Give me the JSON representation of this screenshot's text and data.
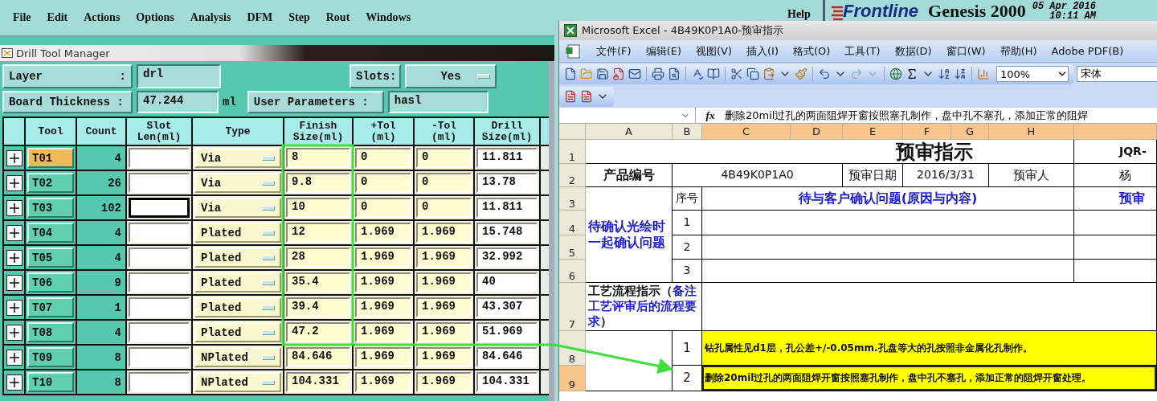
{
  "genesis": {
    "menu": [
      "File",
      "Edit",
      "Actions",
      "Options",
      "Analysis",
      "DFM",
      "Step",
      "Rout",
      "Windows"
    ],
    "help": "Help",
    "brand": "Frontline",
    "product": "Genesis 2000",
    "date": "05 Apr 2016",
    "time": "10:11 AM"
  },
  "drill_manager": {
    "title": "Drill Tool Manager",
    "layer_label": "Layer",
    "layer_colon": ":",
    "layer": "drl",
    "slots_label": "Slots:",
    "slots": "Yes",
    "thickness_label": "Board Thickness :",
    "thickness": "47.244",
    "thickness_unit": "ml",
    "user_params_label": "User Parameters :",
    "user_params": "hasl",
    "columns": [
      "Tool",
      "Count",
      "Slot\nLen(ml)",
      "Type",
      "Finish\nSize(ml)",
      "+Tol\n(ml)",
      "-Tol\n(ml)",
      "Drill\nSize(ml)"
    ],
    "rows": [
      {
        "tool": "T01",
        "selected": true,
        "count": "4",
        "slot_focused": false,
        "type": "Via",
        "finish": "8",
        "plus_tol": "0",
        "minus_tol": "0",
        "drill": "11.811"
      },
      {
        "tool": "T02",
        "selected": false,
        "count": "26",
        "slot_focused": false,
        "type": "Via",
        "finish": "9.8",
        "plus_tol": "0",
        "minus_tol": "0",
        "drill": "13.78"
      },
      {
        "tool": "T03",
        "selected": false,
        "count": "102",
        "slot_focused": true,
        "type": "Via",
        "finish": "10",
        "plus_tol": "0",
        "minus_tol": "0",
        "drill": "11.811"
      },
      {
        "tool": "T04",
        "selected": false,
        "count": "4",
        "slot_focused": false,
        "type": "Plated",
        "finish": "12",
        "plus_tol": "1.969",
        "minus_tol": "1.969",
        "drill": "15.748"
      },
      {
        "tool": "T05",
        "selected": false,
        "count": "4",
        "slot_focused": false,
        "type": "Plated",
        "finish": "28",
        "plus_tol": "1.969",
        "minus_tol": "1.969",
        "drill": "32.992"
      },
      {
        "tool": "T06",
        "selected": false,
        "count": "9",
        "slot_focused": false,
        "type": "Plated",
        "finish": "35.4",
        "plus_tol": "1.969",
        "minus_tol": "1.969",
        "drill": "40"
      },
      {
        "tool": "T07",
        "selected": false,
        "count": "1",
        "slot_focused": false,
        "type": "Plated",
        "finish": "39.4",
        "plus_tol": "1.969",
        "minus_tol": "1.969",
        "drill": "43.307"
      },
      {
        "tool": "T08",
        "selected": false,
        "count": "4",
        "slot_focused": false,
        "type": "Plated",
        "finish": "47.2",
        "plus_tol": "1.969",
        "minus_tol": "1.969",
        "drill": "51.969"
      },
      {
        "tool": "T09",
        "selected": false,
        "count": "8",
        "slot_focused": false,
        "type": "NPlated",
        "finish": "84.646",
        "plus_tol": "1.969",
        "minus_tol": "1.969",
        "drill": "84.646"
      },
      {
        "tool": "T10",
        "selected": false,
        "count": "8",
        "slot_focused": false,
        "type": "NPlated",
        "finish": "104.331",
        "plus_tol": "1.969",
        "minus_tol": "1.969",
        "drill": "104.331"
      }
    ]
  },
  "excel": {
    "title": "Microsoft Excel - 4B49K0P1A0-预审指示",
    "menu": [
      "文件(F)",
      "编辑(E)",
      "视图(V)",
      "插入(I)",
      "格式(O)",
      "工具(T)",
      "数据(D)",
      "窗口(W)",
      "帮助(H)",
      "Adobe PDF(B)"
    ],
    "zoom": "100%",
    "font": "宋体",
    "fx": "fx",
    "formula": "删除20mil过孔的两面阻焊开窗按照塞孔制作，盘中孔不塞孔，添加正常的阻焊",
    "column_headers": [
      {
        "label": "A",
        "selected": false
      },
      {
        "label": "B",
        "selected": false
      },
      {
        "label": "C",
        "selected": true
      },
      {
        "label": "D",
        "selected": true
      },
      {
        "label": "E",
        "selected": true
      },
      {
        "label": "F",
        "selected": true
      },
      {
        "label": "G",
        "selected": true
      },
      {
        "label": "H",
        "selected": true
      },
      {
        "selected": true
      }
    ],
    "row_headers": [
      {
        "label": "1",
        "selected": false
      },
      {
        "label": "2",
        "selected": false
      },
      {
        "label": "3",
        "selected": false
      },
      {
        "label": "4",
        "selected": false
      },
      {
        "label": "5",
        "selected": false
      },
      {
        "label": "6",
        "selected": false
      },
      {
        "label": "7",
        "selected": false
      },
      {
        "label": "8",
        "selected": false
      },
      {
        "label": "9",
        "selected": true
      }
    ],
    "sheet": {
      "title": "预审指示",
      "doc_code": "JQR-",
      "product_label": "产品编号",
      "product_no": "4B49K0P1A0",
      "date_label": "预审日期",
      "date": "2016/3/31",
      "reviewer_label": "预审人",
      "reviewer": "杨",
      "no_label": "序号",
      "questions_title": "待与客户确认问题(原因与内容)",
      "review_title": "预审",
      "pending_label": "待确认光绘时一起确认问题",
      "questions": [
        "1",
        "2",
        "3"
      ],
      "process_label": {
        "lead": "工艺流程指示（",
        "note": "备注工艺评审后的流程要求",
        "tail": "）"
      },
      "instructions": [
        {
          "no": "1",
          "text": "钻孔属性见d1层，孔公差+/-0.05mm.孔盘等大的孔按照非金属化孔制作。",
          "selected": false
        },
        {
          "no": "2",
          "text": "删除20mil过孔的两面阻焊开窗按照塞孔制作，盘中孔不塞孔，添加正常的阻焊开窗处理。",
          "selected": true
        }
      ]
    }
  }
}
